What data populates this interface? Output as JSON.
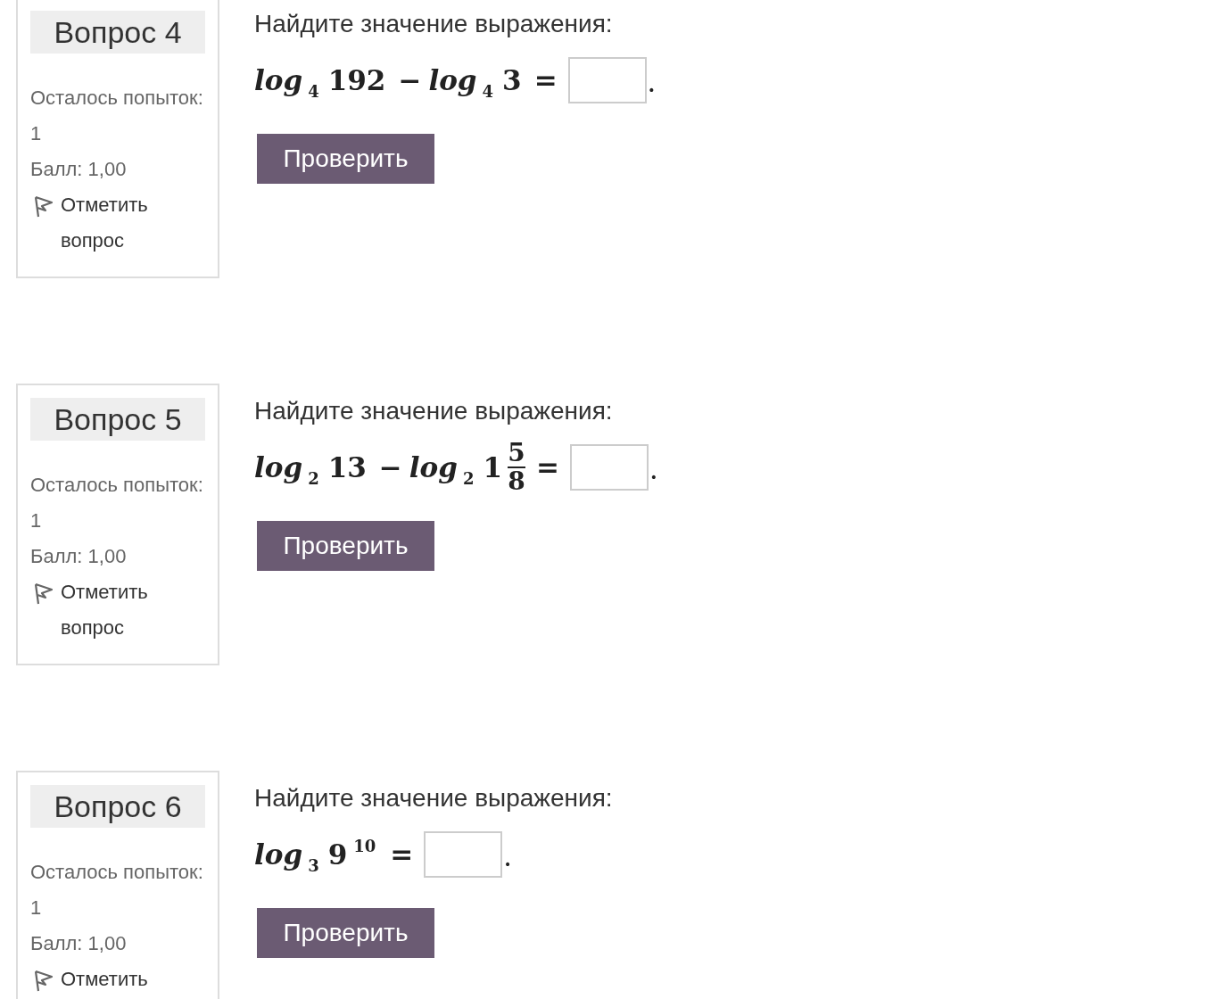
{
  "questions": [
    {
      "title": "Вопрос 4",
      "attempts": "Осталось попыток: 1",
      "grade": "Балл: 1,00",
      "flag": "Отметить вопрос",
      "prompt": "Найдите значение выражения:",
      "formula": [
        {
          "kind": "fn",
          "text": "log"
        },
        {
          "kind": "sub",
          "text": "4"
        },
        {
          "kind": "num",
          "text": "192"
        },
        {
          "kind": "op",
          "text": "−"
        },
        {
          "kind": "fn",
          "text": "log"
        },
        {
          "kind": "sub",
          "text": "4"
        },
        {
          "kind": "num",
          "text": "3"
        },
        {
          "kind": "op",
          "text": "="
        }
      ],
      "suffix": ".",
      "button": "Проверить"
    },
    {
      "title": "Вопрос 5",
      "attempts": "Осталось попыток: 1",
      "grade": "Балл: 1,00",
      "flag": "Отметить вопрос",
      "prompt": "Найдите значение выражения:",
      "formula": [
        {
          "kind": "fn",
          "text": "log"
        },
        {
          "kind": "sub",
          "text": "2"
        },
        {
          "kind": "num",
          "text": "13"
        },
        {
          "kind": "op",
          "text": "−"
        },
        {
          "kind": "fn",
          "text": "log"
        },
        {
          "kind": "sub",
          "text": "2"
        },
        {
          "kind": "num",
          "text": "1"
        },
        {
          "kind": "frac",
          "num": "5",
          "den": "8"
        },
        {
          "kind": "op",
          "text": "="
        }
      ],
      "suffix": ".",
      "button": "Проверить"
    },
    {
      "title": "Вопрос 6",
      "attempts": "Осталось попыток: 1",
      "grade": "Балл: 1,00",
      "flag": "Отметить",
      "prompt": "Найдите значение выражения:",
      "formula": [
        {
          "kind": "fn",
          "text": "log"
        },
        {
          "kind": "sub",
          "text": "3"
        },
        {
          "kind": "num",
          "text": "9"
        },
        {
          "kind": "sup",
          "text": "10"
        },
        {
          "kind": "op",
          "text": "="
        }
      ],
      "suffix": ".",
      "button": "Проверить"
    }
  ]
}
